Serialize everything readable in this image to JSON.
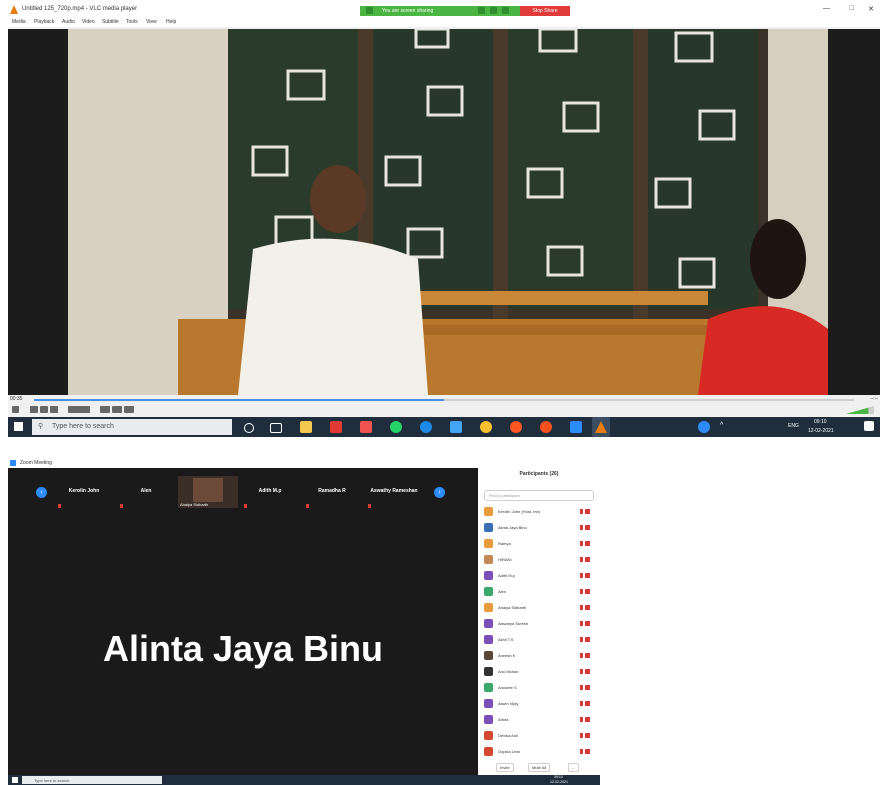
{
  "vlc": {
    "title": "Untitled 125_720p.mp4 - VLC media player",
    "menu": [
      "Media",
      "Playback",
      "Audio",
      "Video",
      "Subtitle",
      "Tools",
      "View",
      "Help"
    ],
    "share_status": "You are screen sharing",
    "stop_share": "Stop Share",
    "time_elapsed": "00:35",
    "time_total": "--:--",
    "progress_fraction": 0.5,
    "volume_fraction": 0.8
  },
  "taskbar1": {
    "search_placeholder": "Type here to search",
    "clock_time": "09:10",
    "clock_date": "12-02-2021",
    "lang": "ENG"
  },
  "zoom": {
    "title": "Zoom Meeting",
    "thumbnails": [
      "Kerolin John",
      "Alen",
      "Ahalya Sidharth",
      "Adith M.p",
      "Ramadha R",
      "Aswathy Rameshan"
    ],
    "active_speaker": "Alinta Jaya Binu",
    "participants_header": "Participants (26)",
    "search_placeholder": "Find a participant",
    "participants": [
      {
        "name": "Kerolin John (Host, me)",
        "color": "#e89b3a"
      },
      {
        "name": "Alinta Jaya Binu",
        "color": "#3a6fb5"
      },
      {
        "name": "Ramya",
        "color": "#e89b3a"
      },
      {
        "name": "HIRANI",
        "color": "#c48a55"
      },
      {
        "name": "Adith M.p",
        "color": "#7b4fb8"
      },
      {
        "name": "Alen",
        "color": "#3aa86b"
      },
      {
        "name": "Ahalya Sidharth",
        "color": "#e89b3a"
      },
      {
        "name": "Aiswarya Suresh",
        "color": "#7b4fb8"
      },
      {
        "name": "Akhil T.S",
        "color": "#7b4fb8"
      },
      {
        "name": "Aneesh K",
        "color": "#5a4636"
      },
      {
        "name": "Anu Mohan",
        "color": "#333333"
      },
      {
        "name": "Anusree S",
        "color": "#3aa86b"
      },
      {
        "name": "Aswin Vijay",
        "color": "#7b4fb8"
      },
      {
        "name": "Athira",
        "color": "#7b4fb8"
      },
      {
        "name": "Devika Anil",
        "color": "#d24a2e"
      },
      {
        "name": "Gopika Unni",
        "color": "#d24a2e"
      }
    ],
    "invite": "Invite",
    "mute_all": "Mute All",
    "more": "..."
  },
  "taskbar2": {
    "search_placeholder": "Type here to search",
    "clock_time": "09:10",
    "clock_date": "12-02-2021"
  }
}
